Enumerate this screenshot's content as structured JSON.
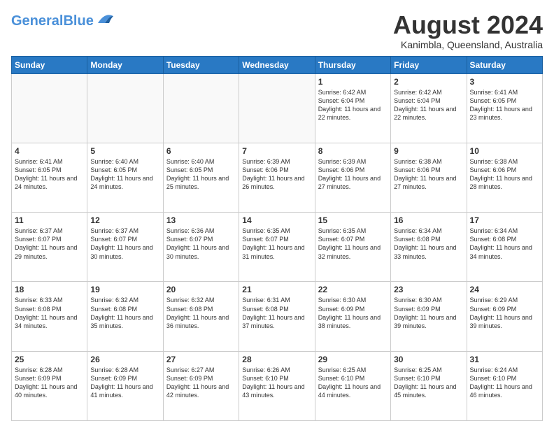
{
  "header": {
    "logo_general": "General",
    "logo_blue": "Blue",
    "title": "August 2024",
    "location": "Kanimbla, Queensland, Australia"
  },
  "weekdays": [
    "Sunday",
    "Monday",
    "Tuesday",
    "Wednesday",
    "Thursday",
    "Friday",
    "Saturday"
  ],
  "weeks": [
    [
      {
        "day": "",
        "sunrise": "",
        "sunset": "",
        "daylight": ""
      },
      {
        "day": "",
        "sunrise": "",
        "sunset": "",
        "daylight": ""
      },
      {
        "day": "",
        "sunrise": "",
        "sunset": "",
        "daylight": ""
      },
      {
        "day": "",
        "sunrise": "",
        "sunset": "",
        "daylight": ""
      },
      {
        "day": "1",
        "sunrise": "Sunrise: 6:42 AM",
        "sunset": "Sunset: 6:04 PM",
        "daylight": "Daylight: 11 hours and 22 minutes."
      },
      {
        "day": "2",
        "sunrise": "Sunrise: 6:42 AM",
        "sunset": "Sunset: 6:04 PM",
        "daylight": "Daylight: 11 hours and 22 minutes."
      },
      {
        "day": "3",
        "sunrise": "Sunrise: 6:41 AM",
        "sunset": "Sunset: 6:05 PM",
        "daylight": "Daylight: 11 hours and 23 minutes."
      }
    ],
    [
      {
        "day": "4",
        "sunrise": "Sunrise: 6:41 AM",
        "sunset": "Sunset: 6:05 PM",
        "daylight": "Daylight: 11 hours and 24 minutes."
      },
      {
        "day": "5",
        "sunrise": "Sunrise: 6:40 AM",
        "sunset": "Sunset: 6:05 PM",
        "daylight": "Daylight: 11 hours and 24 minutes."
      },
      {
        "day": "6",
        "sunrise": "Sunrise: 6:40 AM",
        "sunset": "Sunset: 6:05 PM",
        "daylight": "Daylight: 11 hours and 25 minutes."
      },
      {
        "day": "7",
        "sunrise": "Sunrise: 6:39 AM",
        "sunset": "Sunset: 6:06 PM",
        "daylight": "Daylight: 11 hours and 26 minutes."
      },
      {
        "day": "8",
        "sunrise": "Sunrise: 6:39 AM",
        "sunset": "Sunset: 6:06 PM",
        "daylight": "Daylight: 11 hours and 27 minutes."
      },
      {
        "day": "9",
        "sunrise": "Sunrise: 6:38 AM",
        "sunset": "Sunset: 6:06 PM",
        "daylight": "Daylight: 11 hours and 27 minutes."
      },
      {
        "day": "10",
        "sunrise": "Sunrise: 6:38 AM",
        "sunset": "Sunset: 6:06 PM",
        "daylight": "Daylight: 11 hours and 28 minutes."
      }
    ],
    [
      {
        "day": "11",
        "sunrise": "Sunrise: 6:37 AM",
        "sunset": "Sunset: 6:07 PM",
        "daylight": "Daylight: 11 hours and 29 minutes."
      },
      {
        "day": "12",
        "sunrise": "Sunrise: 6:37 AM",
        "sunset": "Sunset: 6:07 PM",
        "daylight": "Daylight: 11 hours and 30 minutes."
      },
      {
        "day": "13",
        "sunrise": "Sunrise: 6:36 AM",
        "sunset": "Sunset: 6:07 PM",
        "daylight": "Daylight: 11 hours and 30 minutes."
      },
      {
        "day": "14",
        "sunrise": "Sunrise: 6:35 AM",
        "sunset": "Sunset: 6:07 PM",
        "daylight": "Daylight: 11 hours and 31 minutes."
      },
      {
        "day": "15",
        "sunrise": "Sunrise: 6:35 AM",
        "sunset": "Sunset: 6:07 PM",
        "daylight": "Daylight: 11 hours and 32 minutes."
      },
      {
        "day": "16",
        "sunrise": "Sunrise: 6:34 AM",
        "sunset": "Sunset: 6:08 PM",
        "daylight": "Daylight: 11 hours and 33 minutes."
      },
      {
        "day": "17",
        "sunrise": "Sunrise: 6:34 AM",
        "sunset": "Sunset: 6:08 PM",
        "daylight": "Daylight: 11 hours and 34 minutes."
      }
    ],
    [
      {
        "day": "18",
        "sunrise": "Sunrise: 6:33 AM",
        "sunset": "Sunset: 6:08 PM",
        "daylight": "Daylight: 11 hours and 34 minutes."
      },
      {
        "day": "19",
        "sunrise": "Sunrise: 6:32 AM",
        "sunset": "Sunset: 6:08 PM",
        "daylight": "Daylight: 11 hours and 35 minutes."
      },
      {
        "day": "20",
        "sunrise": "Sunrise: 6:32 AM",
        "sunset": "Sunset: 6:08 PM",
        "daylight": "Daylight: 11 hours and 36 minutes."
      },
      {
        "day": "21",
        "sunrise": "Sunrise: 6:31 AM",
        "sunset": "Sunset: 6:08 PM",
        "daylight": "Daylight: 11 hours and 37 minutes."
      },
      {
        "day": "22",
        "sunrise": "Sunrise: 6:30 AM",
        "sunset": "Sunset: 6:09 PM",
        "daylight": "Daylight: 11 hours and 38 minutes."
      },
      {
        "day": "23",
        "sunrise": "Sunrise: 6:30 AM",
        "sunset": "Sunset: 6:09 PM",
        "daylight": "Daylight: 11 hours and 39 minutes."
      },
      {
        "day": "24",
        "sunrise": "Sunrise: 6:29 AM",
        "sunset": "Sunset: 6:09 PM",
        "daylight": "Daylight: 11 hours and 39 minutes."
      }
    ],
    [
      {
        "day": "25",
        "sunrise": "Sunrise: 6:28 AM",
        "sunset": "Sunset: 6:09 PM",
        "daylight": "Daylight: 11 hours and 40 minutes."
      },
      {
        "day": "26",
        "sunrise": "Sunrise: 6:28 AM",
        "sunset": "Sunset: 6:09 PM",
        "daylight": "Daylight: 11 hours and 41 minutes."
      },
      {
        "day": "27",
        "sunrise": "Sunrise: 6:27 AM",
        "sunset": "Sunset: 6:09 PM",
        "daylight": "Daylight: 11 hours and 42 minutes."
      },
      {
        "day": "28",
        "sunrise": "Sunrise: 6:26 AM",
        "sunset": "Sunset: 6:10 PM",
        "daylight": "Daylight: 11 hours and 43 minutes."
      },
      {
        "day": "29",
        "sunrise": "Sunrise: 6:25 AM",
        "sunset": "Sunset: 6:10 PM",
        "daylight": "Daylight: 11 hours and 44 minutes."
      },
      {
        "day": "30",
        "sunrise": "Sunrise: 6:25 AM",
        "sunset": "Sunset: 6:10 PM",
        "daylight": "Daylight: 11 hours and 45 minutes."
      },
      {
        "day": "31",
        "sunrise": "Sunrise: 6:24 AM",
        "sunset": "Sunset: 6:10 PM",
        "daylight": "Daylight: 11 hours and 46 minutes."
      }
    ]
  ]
}
